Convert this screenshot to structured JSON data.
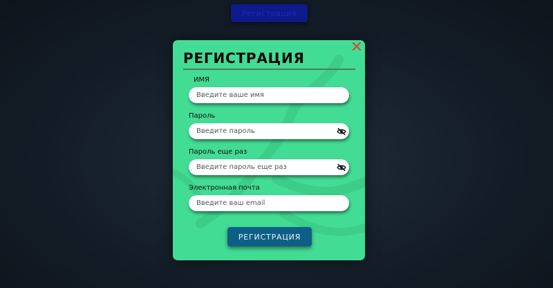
{
  "top_button": {
    "label": "Регистрация"
  },
  "modal": {
    "title": "РЕГИСТРАЦИЯ",
    "close_icon": "close-icon",
    "fields": [
      {
        "label": "ИМЯ",
        "placeholder": "Введите ваше имя",
        "value": "",
        "type": "text"
      },
      {
        "label": "Пароль",
        "placeholder": "Введите пароль",
        "value": "",
        "type": "password",
        "icon": "eye-slash-icon"
      },
      {
        "label": "Пароль еще раз",
        "placeholder": "Введите пароль еще раз",
        "value": "",
        "type": "password",
        "icon": "eye-slash-icon"
      },
      {
        "label": "Электронная почта",
        "placeholder": "Введите ваш email",
        "value": "",
        "type": "email"
      }
    ],
    "submit_label": "РЕГИСТРАЦИЯ"
  },
  "colors": {
    "background": "#131c26",
    "modal": "#43dc95",
    "submit": "#0e5f86",
    "close": "#d14a3c",
    "top_button": "#0c1a8c"
  }
}
